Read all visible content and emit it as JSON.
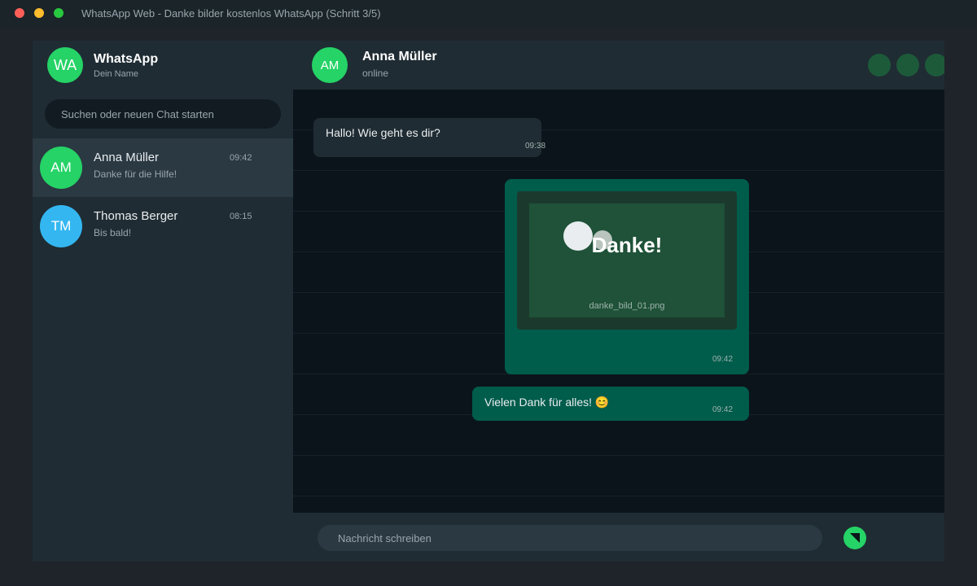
{
  "window": {
    "title": "WhatsApp Web - Danke bilder kostenlos WhatsApp (Schritt 3/5)"
  },
  "sidebar": {
    "profile": {
      "initials": "WA",
      "name": "WhatsApp",
      "subtitle": "Dein Name"
    },
    "search": {
      "placeholder": "Suchen oder neuen Chat starten",
      "value": ""
    },
    "chats": [
      {
        "initials": "AM",
        "name": "Anna Müller",
        "time": "09:42",
        "preview": "Danke für die Hilfe!",
        "color": "#25d366",
        "active": true
      },
      {
        "initials": "TM",
        "name": "Thomas Berger",
        "time": "08:15",
        "preview": "Bis bald!",
        "color": "#34b7f1",
        "active": false
      }
    ]
  },
  "chat": {
    "header": {
      "initials": "AM",
      "name": "Anna Müller",
      "status": "online"
    },
    "messages": [
      {
        "direction": "in",
        "type": "text",
        "text": "Hallo! Wie geht es dir?",
        "time": "09:38"
      },
      {
        "direction": "out",
        "type": "image",
        "image_text": "Danke!",
        "filename": "danke_bild_01.png",
        "time": "09:42"
      },
      {
        "direction": "out",
        "type": "text",
        "text": "Vielen Dank für alles! 😊",
        "time": "09:42"
      }
    ],
    "composer": {
      "placeholder": "Nachricht schreiben",
      "value": ""
    }
  },
  "colors": {
    "accent": "#25d366",
    "outgoing_bubble": "#005c4b",
    "incoming_bubble": "#202c33"
  }
}
